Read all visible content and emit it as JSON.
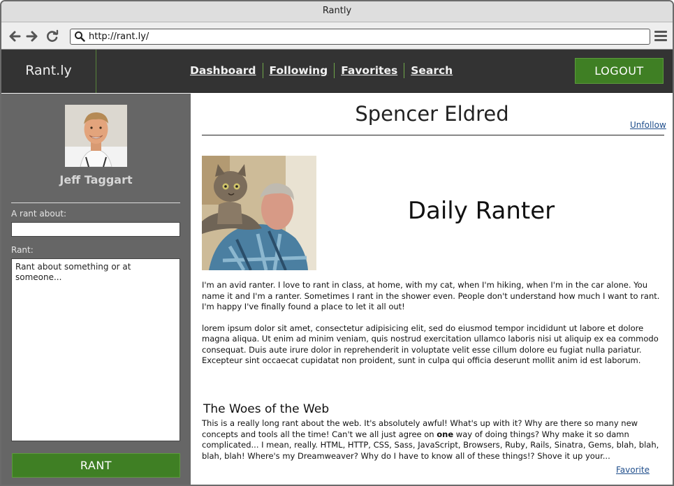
{
  "window": {
    "title": "Rantly"
  },
  "browser": {
    "url": "http://rant.ly/"
  },
  "header": {
    "brand": "Rant.ly",
    "nav": [
      "Dashboard",
      "Following",
      "Favorites",
      "Search"
    ],
    "logout_label": "LOGOUT"
  },
  "sidebar": {
    "user_name": "Jeff Taggart",
    "rant_about_label": "A rant about:",
    "rant_about_value": "",
    "rant_label": "Rant:",
    "rant_placeholder": "Rant about something or at someone...",
    "rant_button": "RANT"
  },
  "profile": {
    "name": "Spencer Eldred",
    "unfollow_label": "Unfollow",
    "tagline": "Daily Ranter",
    "bio": [
      "I'm an avid ranter. I love to rant in class, at home, with my cat, when I'm hiking, when I'm in the car alone. You name it and I'm a ranter. Sometimes I rant in the shower even. People don't understand how much I want to rant. I'm happy I've finally found a place to let it all out!",
      "lorem ipsum dolor sit amet, consectetur adipisicing elit, sed do eiusmod tempor incididunt ut labore et dolore magna aliqua. Ut enim ad minim veniam, quis nostrud exercitation ullamco laboris nisi ut aliquip ex ea commodo consequat. Duis aute irure dolor in reprehenderit in voluptate velit esse cillum dolore eu fugiat nulla pariatur. Excepteur sint occaecat cupidatat non proident, sunt in culpa qui officia deserunt mollit anim id est laborum."
    ]
  },
  "post": {
    "title": "The Woes of the Web",
    "body_before": "This is a really long rant about the web. It's absolutely awful! What's up with it? Why are there so many new concepts and tools all the time! Can't we all just agree on ",
    "body_bold": "one",
    "body_after": " way of doing things? Why make it so damn complicated... I mean, really. HTML, HTTP, CSS, Sass, JavaScript, Browsers, Ruby, Rails, Sinatra, Gems, blah, blah, blah, blah! Where's my Dreamweaver? Why do I have to know all of these things!? Shove it up your...",
    "favorite_label": "Favorite"
  },
  "colors": {
    "header_bg": "#333333",
    "sidebar_bg": "#666666",
    "accent_green": "#3f7f24",
    "link_blue": "#1f4e8c"
  },
  "icons": [
    "back-arrow-icon",
    "forward-arrow-icon",
    "reload-icon",
    "search-icon",
    "hamburger-menu-icon"
  ]
}
